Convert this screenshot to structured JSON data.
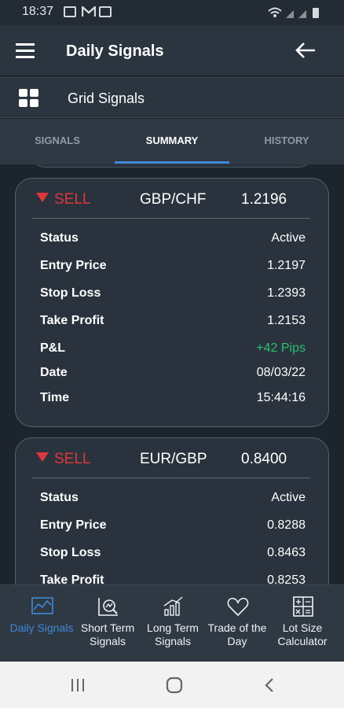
{
  "status_bar": {
    "time": "18:37"
  },
  "app_bar": {
    "title": "Daily Signals"
  },
  "grid_bar": {
    "label": "Grid Signals"
  },
  "tabs": [
    {
      "label": "SIGNALS",
      "active": false
    },
    {
      "label": "SUMMARY",
      "active": true
    },
    {
      "label": "HISTORY",
      "active": false
    }
  ],
  "cards": [
    {
      "type": "SELL",
      "pair": "GBP/CHF",
      "price": "1.2196",
      "rows": [
        {
          "label": "Status",
          "value": "Active"
        },
        {
          "label": "Entry Price",
          "value": "1.2197"
        },
        {
          "label": "Stop Loss",
          "value": "1.2393"
        },
        {
          "label": "Take Profit",
          "value": "1.2153"
        },
        {
          "label": "P&L",
          "value": "+42 Pips"
        },
        {
          "label": "Date",
          "value": "08/03/22"
        },
        {
          "label": "Time",
          "value": "15:44:16"
        }
      ]
    },
    {
      "type": "SELL",
      "pair": "EUR/GBP",
      "price": "0.8400",
      "rows": [
        {
          "label": "Status",
          "value": "Active"
        },
        {
          "label": "Entry Price",
          "value": "0.8288"
        },
        {
          "label": "Stop Loss",
          "value": "0.8463"
        },
        {
          "label": "Take Profit",
          "value": "0.8253"
        }
      ]
    }
  ],
  "bottom_nav": [
    {
      "label": "Daily Signals",
      "icon": "chart-icon",
      "active": true
    },
    {
      "label": "Short Term Signals",
      "icon": "magnifier-chart-icon",
      "active": false
    },
    {
      "label": "Long Term Signals",
      "icon": "bar-growth-icon",
      "active": false
    },
    {
      "label": "Trade of the Day",
      "icon": "heart-icon",
      "active": false
    },
    {
      "label": "Lot Size Calculator",
      "icon": "calculator-icon",
      "active": false
    }
  ],
  "colors": {
    "accent": "#3e88d6",
    "sell": "#e0363a",
    "profit": "#2fbf71"
  }
}
